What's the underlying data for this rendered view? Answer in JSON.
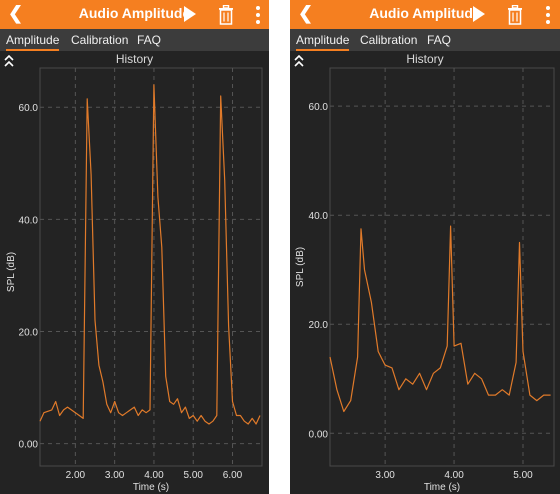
{
  "colors": {
    "accent": "#f57f20",
    "background": "#232323",
    "grid": "#555555",
    "line": "#e07a2a"
  },
  "panels": [
    {
      "appbar": {
        "back_icon": "chevron-left-icon",
        "title": "Audio Amplitude",
        "play_icon": "play-icon",
        "trash_icon": "trash-icon",
        "more_icon": "more-vert-icon"
      },
      "tabs": [
        {
          "label": "Amplitude",
          "active": true
        },
        {
          "label": "Calibration",
          "active": false
        },
        {
          "label": "FAQ",
          "active": false
        }
      ],
      "chart_title": "History",
      "chart_data": {
        "type": "line",
        "title": "History",
        "xlabel": "Time (s)",
        "ylabel": "SPL (dB)",
        "xlim": [
          1.1,
          6.75
        ],
        "ylim": [
          -4,
          67
        ],
        "xticks": [
          "2.00",
          "3.00",
          "4.00",
          "5.00",
          "6.00"
        ],
        "xtick_values": [
          2,
          3,
          4,
          5,
          6
        ],
        "yticks": [
          "0.00",
          "20.0",
          "40.0",
          "60.0"
        ],
        "ytick_values": [
          0,
          20,
          40,
          60
        ],
        "grid": true,
        "series": [
          {
            "x": [
              1.1,
              1.2,
              1.4,
              1.5,
              1.6,
              1.7,
              1.8,
              1.9,
              2.0,
              2.1,
              2.2,
              2.3,
              2.4,
              2.5,
              2.6,
              2.7,
              2.8,
              2.9,
              3.0,
              3.1,
              3.2,
              3.3,
              3.4,
              3.5,
              3.6,
              3.7,
              3.8,
              3.9,
              4.0,
              4.1,
              4.2,
              4.3,
              4.4,
              4.5,
              4.6,
              4.7,
              4.8,
              4.9,
              5.0,
              5.1,
              5.2,
              5.3,
              5.4,
              5.5,
              5.6,
              5.7,
              5.8,
              5.9,
              6.0,
              6.1,
              6.2,
              6.3,
              6.4,
              6.5,
              6.6,
              6.7
            ],
            "y": [
              4,
              5.5,
              6,
              7.5,
              5,
              6,
              6.5,
              6,
              5.5,
              5,
              4.5,
              61.5,
              48,
              22,
              14,
              11,
              7,
              5.5,
              7.5,
              5.5,
              5,
              5.5,
              6,
              6.5,
              5,
              6,
              5.5,
              6,
              64,
              44,
              35,
              12,
              7.5,
              7,
              8,
              5.5,
              6.5,
              4.5,
              5,
              4,
              5,
              4,
              3.5,
              4,
              5,
              62,
              47,
              21,
              7.5,
              5,
              5,
              4,
              3.5,
              4.5,
              3.5,
              5
            ]
          }
        ]
      }
    },
    {
      "appbar": {
        "back_icon": "chevron-left-icon",
        "title": "Audio Amplitude",
        "play_icon": "play-icon",
        "trash_icon": "trash-icon",
        "more_icon": "more-vert-icon"
      },
      "tabs": [
        {
          "label": "Amplitude",
          "active": true
        },
        {
          "label": "Calibration",
          "active": false
        },
        {
          "label": "FAQ",
          "active": false
        }
      ],
      "chart_title": "History",
      "chart_data": {
        "type": "line",
        "title": "History",
        "xlabel": "Time (s)",
        "ylabel": "SPL (dB)",
        "xlim": [
          2.2,
          5.45
        ],
        "ylim": [
          -6,
          67
        ],
        "xticks": [
          "3.00",
          "4.00",
          "5.00"
        ],
        "xtick_values": [
          3,
          4,
          5
        ],
        "yticks": [
          "0.00",
          "20.0",
          "40.0",
          "60.0"
        ],
        "ytick_values": [
          0,
          20,
          40,
          60
        ],
        "grid": true,
        "series": [
          {
            "x": [
              2.2,
              2.3,
              2.4,
              2.5,
              2.6,
              2.65,
              2.7,
              2.8,
              2.9,
              3.0,
              3.1,
              3.2,
              3.3,
              3.4,
              3.5,
              3.6,
              3.7,
              3.8,
              3.9,
              3.95,
              4.0,
              4.1,
              4.2,
              4.3,
              4.4,
              4.5,
              4.6,
              4.7,
              4.8,
              4.9,
              4.95,
              5.0,
              5.1,
              5.2,
              5.3,
              5.4
            ],
            "y": [
              14,
              8,
              4,
              6,
              14,
              37.5,
              30,
              24,
              15,
              12.5,
              12,
              8,
              10,
              9,
              11,
              8,
              11,
              12,
              16,
              38,
              16,
              16.5,
              9,
              11,
              10,
              7,
              7,
              8,
              7,
              13,
              35,
              15,
              7,
              6,
              7,
              7
            ]
          }
        ]
      }
    }
  ]
}
